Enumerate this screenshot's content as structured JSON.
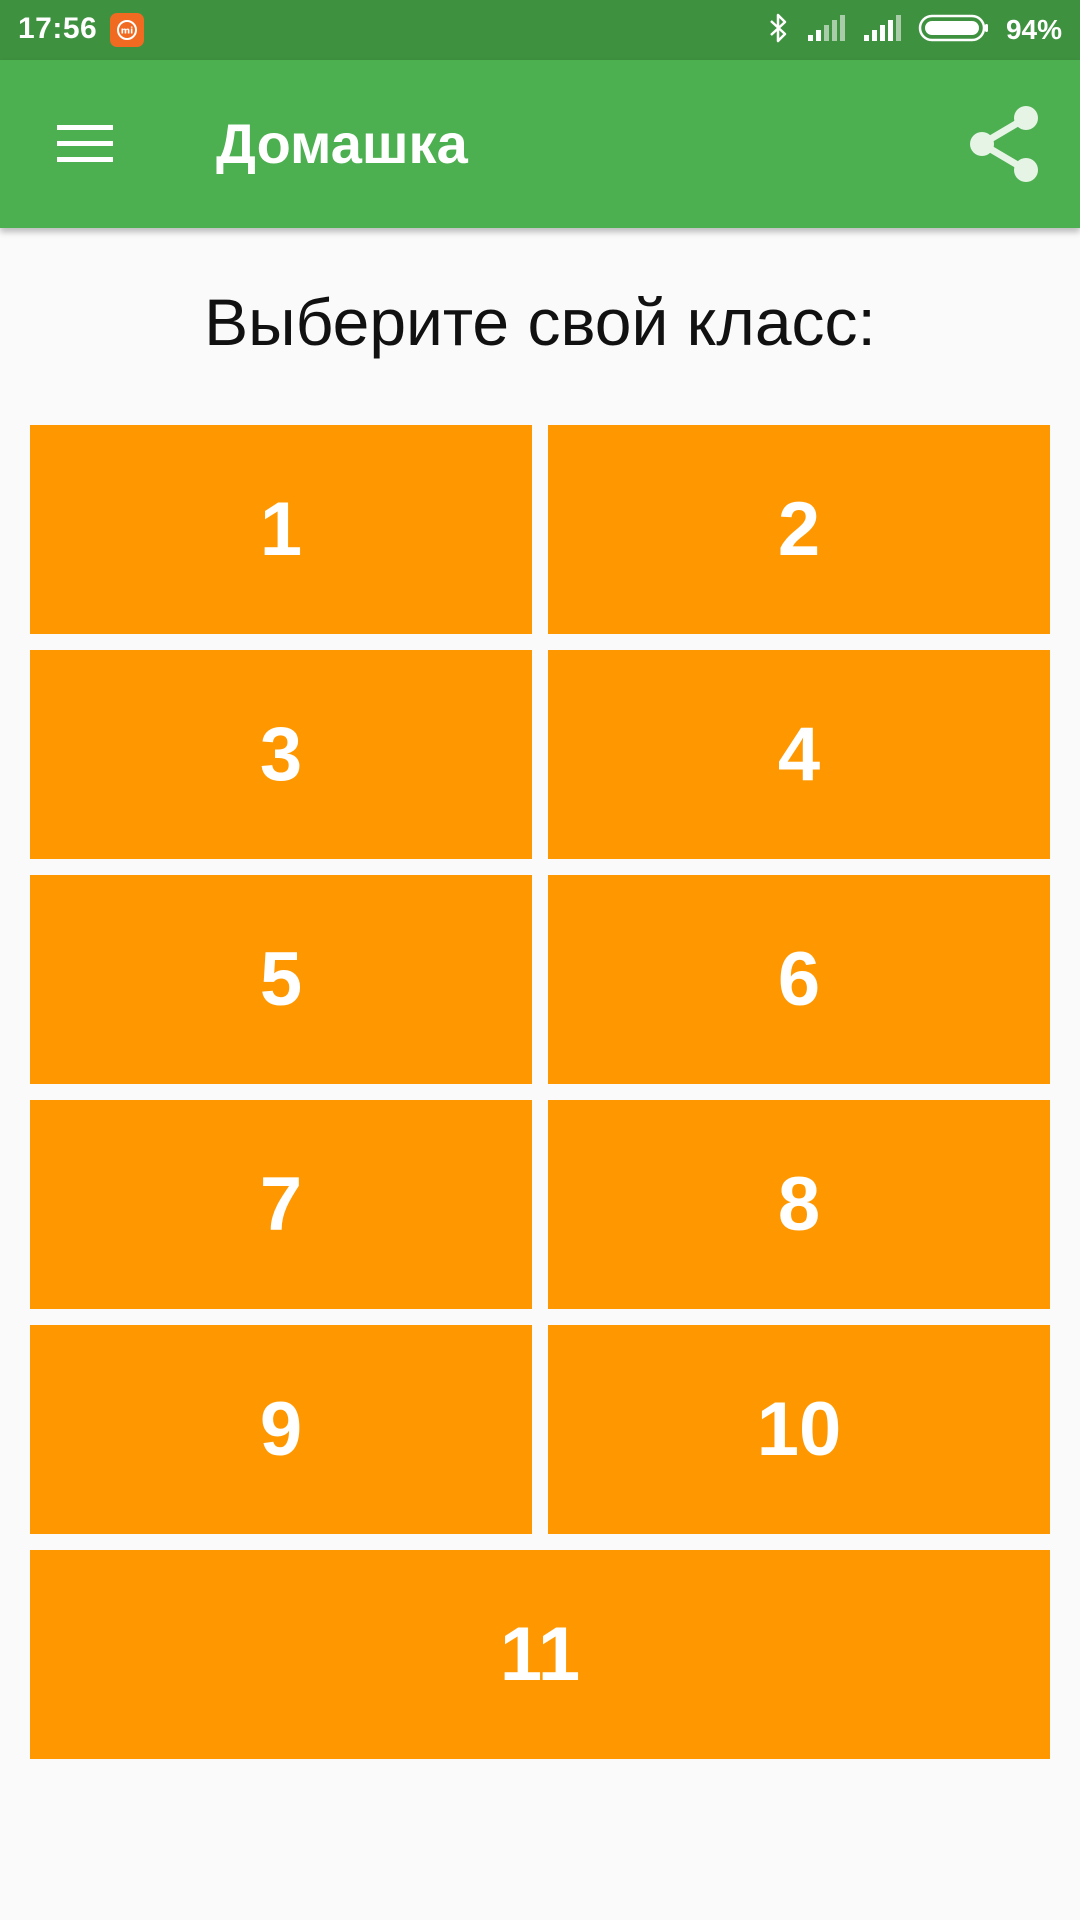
{
  "status_bar": {
    "time": "17:56",
    "battery_percent": "94%",
    "icons": [
      "mi-icon",
      "bluetooth-icon",
      "signal-icon",
      "signal-icon",
      "battery-icon"
    ]
  },
  "app_bar": {
    "title": "Домашка",
    "menu_icon": "hamburger-menu-icon",
    "share_icon": "share-icon",
    "color": "#4caf50"
  },
  "main": {
    "prompt": "Выберите свой класс:",
    "class_buttons": [
      "1",
      "2",
      "3",
      "4",
      "5",
      "6",
      "7",
      "8",
      "9",
      "10",
      "11"
    ],
    "button_color": "#ff9800"
  }
}
